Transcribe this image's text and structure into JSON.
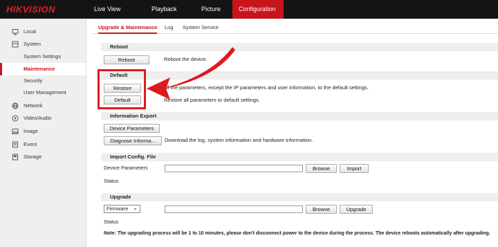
{
  "app": {
    "logo": "HIKVISION"
  },
  "topnav": [
    "Live View",
    "Playback",
    "Picture",
    "Configuration"
  ],
  "sidebar": {
    "items": [
      {
        "label": "Local",
        "icon": "monitor-icon"
      },
      {
        "label": "System",
        "icon": "system-icon"
      },
      {
        "label": "System Settings"
      },
      {
        "label": "Maintenance"
      },
      {
        "label": "Security"
      },
      {
        "label": "User Management"
      },
      {
        "label": "Network",
        "icon": "globe-icon"
      },
      {
        "label": "Video/Audio",
        "icon": "video-icon"
      },
      {
        "label": "Image",
        "icon": "image-icon"
      },
      {
        "label": "Event",
        "icon": "event-icon"
      },
      {
        "label": "Storage",
        "icon": "storage-icon"
      }
    ]
  },
  "tabs": [
    "Upgrade & Maintenance",
    "Log",
    "System Service"
  ],
  "reboot": {
    "title": "Reboot",
    "button": "Reboot",
    "desc": "Reboot the device."
  },
  "default": {
    "title": "Default",
    "restore_button": "Restore",
    "restore_desc": "all the parameters, except the IP parameters and user information, to the default settings.",
    "default_button": "Default",
    "default_desc": "Restore all parameters to default settings."
  },
  "export": {
    "title": "Information Export",
    "device_params_button": "Device Parameters",
    "diagnose_button": "Diagnose Informa...",
    "diagnose_desc": "Download the log, system information and hardware information."
  },
  "import": {
    "title": "Import Config. File",
    "label": "Device Parameters",
    "browse": "Browse",
    "import": "Import",
    "status": "Status"
  },
  "upgrade": {
    "title": "Upgrade",
    "select_value": "Firmware",
    "browse": "Browse",
    "upgrade": "Upgrade",
    "status": "Status",
    "note": "Note: The upgrading process will be 1 to 10 minutes, please don't disconnect power to the device during the process. The device reboots automatically after upgrading."
  },
  "colors": {
    "accent": "#c8151b",
    "annotation": "#e0191f"
  }
}
